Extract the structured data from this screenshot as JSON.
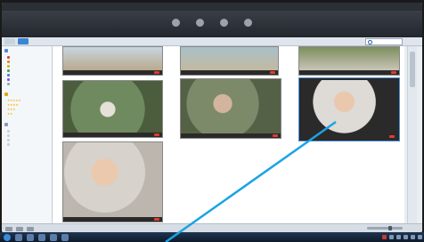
{
  "app": {
    "menubar_items": [
      "",
      "",
      "",
      "",
      ""
    ],
    "toolbar_buttons": [
      {
        "icon": "image-icon",
        "label": ""
      },
      {
        "icon": "camera-icon",
        "label": ""
      },
      {
        "icon": "video-icon",
        "label": ""
      },
      {
        "icon": "share-icon",
        "label": ""
      }
    ],
    "tabs": [
      "",
      ""
    ],
    "breadcrumb": "",
    "search_placeholder": ""
  },
  "sidebar": {
    "sections": [
      {
        "title": "",
        "icon": "folder-icon",
        "items": [
          "",
          "",
          "",
          "",
          "",
          "",
          ""
        ]
      },
      {
        "title": "",
        "icon": "star-icon",
        "stars": [
          "★★★★★",
          "★★★★",
          "★★★",
          "★★"
        ]
      },
      {
        "title": "",
        "icon": "library-icon",
        "items": [
          "",
          "",
          "",
          ""
        ]
      }
    ]
  },
  "thumbnails": [
    {
      "desc": "beach-photo",
      "color": "#7e9bb0",
      "selected": false
    },
    {
      "desc": "beach-photo",
      "color": "#9aaf9f",
      "selected": false
    },
    {
      "desc": "wedding-photo",
      "color": "#6e7d56",
      "selected": false
    },
    {
      "desc": "group-photo",
      "color": "#6e8a67",
      "selected": false
    },
    {
      "desc": "baby-photo",
      "color": "#7c8a6a",
      "selected": false
    },
    {
      "desc": "baby-photo",
      "color": "#d9d4d0",
      "selected": true
    },
    {
      "desc": "baby-closeup-photo",
      "color": "#c9c3bd",
      "selected": false
    }
  ],
  "colors": {
    "accent": "#3a86d4",
    "callout_line": "#1aa3e6",
    "badge_red": "#e23b2f"
  }
}
